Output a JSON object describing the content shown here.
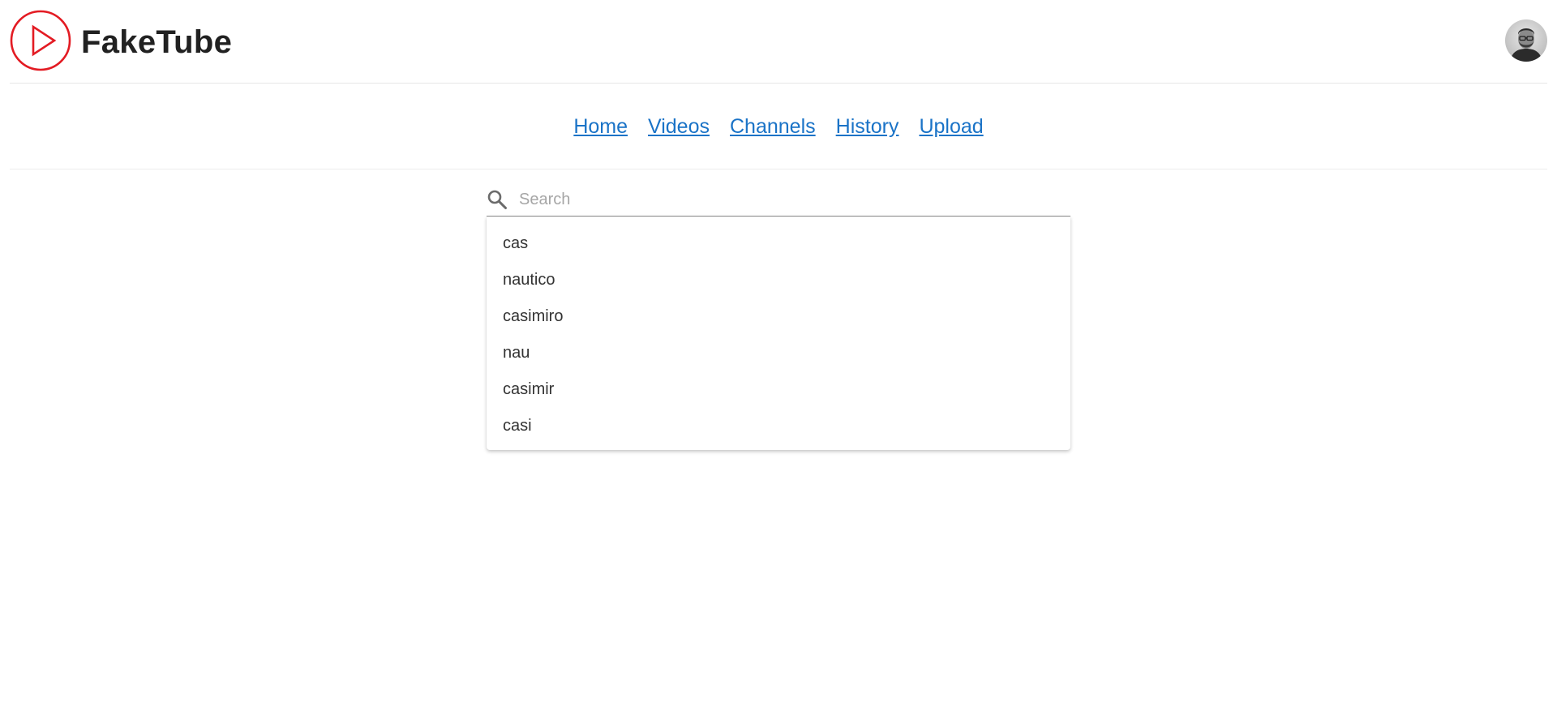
{
  "app": {
    "brand": "FakeTube",
    "logo_icon": "play-circle-icon",
    "brand_color": "#e31b23",
    "avatar_icon": "user-avatar-photo"
  },
  "nav": {
    "link_color": "#1a73c7",
    "items": [
      {
        "label": "Home"
      },
      {
        "label": "Videos"
      },
      {
        "label": "Channels"
      },
      {
        "label": "History"
      },
      {
        "label": "Upload"
      }
    ]
  },
  "search": {
    "icon": "search-icon",
    "placeholder": "Search",
    "value": "",
    "suggestions": [
      {
        "label": "cas"
      },
      {
        "label": "nautico"
      },
      {
        "label": "casimiro"
      },
      {
        "label": "nau"
      },
      {
        "label": "casimir"
      },
      {
        "label": "casi"
      }
    ]
  }
}
